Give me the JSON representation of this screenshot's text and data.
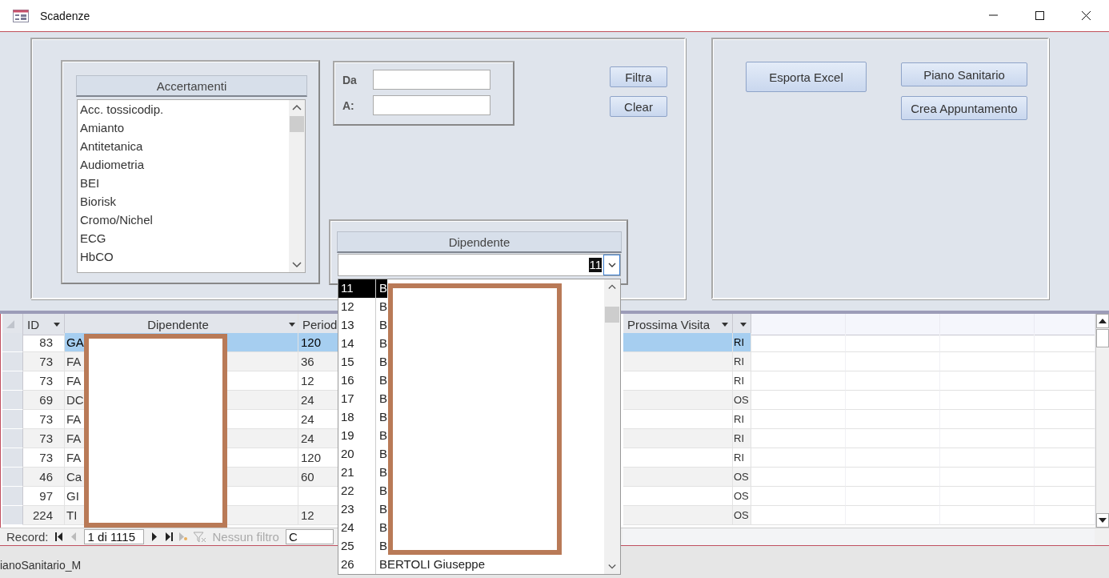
{
  "window": {
    "title": "Scadenze"
  },
  "accertamenti": {
    "header": "Accertamenti",
    "items": [
      "Acc. tossicodip.",
      "Amianto",
      "Antitetanica",
      "Audiometria",
      "BEI",
      "Biorisk",
      "Cromo/Nichel",
      "ECG",
      "HbCO"
    ]
  },
  "date_range": [
    {
      "label": "Da"
    },
    {
      "label": "A:"
    }
  ],
  "filter_buttons": [
    "Filtra",
    "Clear"
  ],
  "action_buttons": [
    "Esporta Excel",
    "Piano Sanitario",
    "Crea Appuntamento"
  ],
  "dipendente_combo": {
    "header": "Dipendente",
    "value": "11"
  },
  "dropdown": {
    "rows": [
      {
        "id": "11",
        "name": "B",
        "selected": true
      },
      {
        "id": "12",
        "name": "B",
        "selected": false
      },
      {
        "id": "13",
        "name": "B",
        "selected": false
      },
      {
        "id": "14",
        "name": "B",
        "selected": false
      },
      {
        "id": "15",
        "name": "B",
        "selected": false
      },
      {
        "id": "16",
        "name": "B",
        "selected": false
      },
      {
        "id": "17",
        "name": "B",
        "selected": false
      },
      {
        "id": "18",
        "name": "B",
        "selected": false
      },
      {
        "id": "19",
        "name": "B",
        "selected": false
      },
      {
        "id": "20",
        "name": "B",
        "selected": false
      },
      {
        "id": "21",
        "name": "B",
        "selected": false
      },
      {
        "id": "22",
        "name": "B",
        "selected": false
      },
      {
        "id": "23",
        "name": "B",
        "selected": false
      },
      {
        "id": "24",
        "name": "B",
        "selected": false
      },
      {
        "id": "25",
        "name": "B",
        "selected": false
      },
      {
        "id": "26",
        "name": "BERTOLI Giuseppe",
        "selected": false
      }
    ]
  },
  "table": {
    "columns": [
      "ID",
      "Dipendente",
      "Period",
      "Prossima Visita"
    ],
    "rows": [
      {
        "id": "83",
        "dipendente": "GA",
        "period": "120",
        "column_5": "RI",
        "selected": true
      },
      {
        "id": "73",
        "dipendente": "FA",
        "period": "36",
        "column_5": "RI",
        "selected": false
      },
      {
        "id": "73",
        "dipendente": "FA",
        "period": "12",
        "column_5": "RI",
        "selected": false
      },
      {
        "id": "69",
        "dipendente": "DC",
        "period": "24",
        "column_5": "OS",
        "selected": false
      },
      {
        "id": "73",
        "dipendente": "FA",
        "period": "24",
        "column_5": "RI",
        "selected": false
      },
      {
        "id": "73",
        "dipendente": "FA",
        "period": "24",
        "column_5": "RI",
        "selected": false
      },
      {
        "id": "73",
        "dipendente": "FA",
        "period": "120",
        "column_5": "RI",
        "selected": false
      },
      {
        "id": "46",
        "dipendente": "Ca",
        "period": "60",
        "column_5": "OS",
        "selected": false
      },
      {
        "id": "97",
        "dipendente": "GI",
        "column_5": "OS",
        "selected": false
      },
      {
        "id": "224",
        "dipendente": "TI",
        "period": "12",
        "column_5": "OS",
        "selected": false
      }
    ]
  },
  "record_nav": {
    "label": "Record:",
    "position": "1 di 1115",
    "filter": "Nessun filtro",
    "search": "C"
  },
  "background_text": "ianoSanitario_M"
}
